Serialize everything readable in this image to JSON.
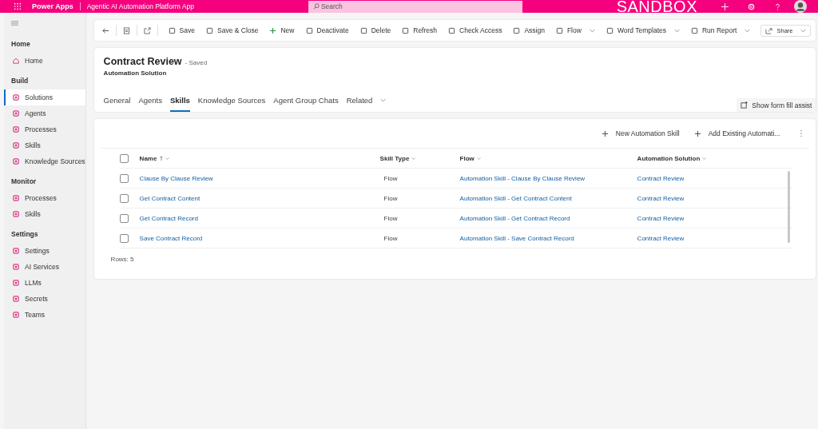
{
  "top_bar": {
    "app_name": "Power Apps",
    "app_title": "Agentic AI Automation Platform App",
    "search": {
      "placeholder": "Search"
    },
    "environment": "SANDBOX"
  },
  "sidebar": {
    "sections": [
      {
        "title": "Home",
        "items": [
          {
            "label": "Home",
            "selected": false
          }
        ]
      },
      {
        "title": "Build",
        "items": [
          {
            "label": "Solutions",
            "selected": true
          },
          {
            "label": "Agents",
            "selected": false
          },
          {
            "label": "Processes",
            "selected": false
          },
          {
            "label": "Skills",
            "selected": false
          },
          {
            "label": "Knowledge Sources",
            "selected": false
          }
        ]
      },
      {
        "title": "Monitor",
        "items": [
          {
            "label": "Processes",
            "selected": false
          },
          {
            "label": "Skills",
            "selected": false
          }
        ]
      },
      {
        "title": "Settings",
        "items": [
          {
            "label": "Settings",
            "selected": false
          },
          {
            "label": "AI Services",
            "selected": false
          },
          {
            "label": "LLMs",
            "selected": false
          },
          {
            "label": "Secrets",
            "selected": false
          },
          {
            "label": "Teams",
            "selected": false
          }
        ]
      }
    ]
  },
  "command_bar": {
    "buttons": [
      {
        "label": "Save",
        "dropdown": false
      },
      {
        "label": "Save & Close",
        "dropdown": false
      },
      {
        "label": "New",
        "dropdown": false
      },
      {
        "label": "Deactivate",
        "dropdown": false
      },
      {
        "label": "Delete",
        "dropdown": false
      },
      {
        "label": "Refresh",
        "dropdown": false
      },
      {
        "label": "Check Access",
        "dropdown": false
      },
      {
        "label": "Assign",
        "dropdown": false
      },
      {
        "label": "Flow",
        "dropdown": true
      },
      {
        "label": "Word Templates",
        "dropdown": true
      },
      {
        "label": "Run Report",
        "dropdown": true
      }
    ],
    "share": "Share"
  },
  "form": {
    "title": "Contract Review",
    "status": "- Saved",
    "entity": "Automation Solution",
    "tabs": [
      {
        "label": "General",
        "selected": false
      },
      {
        "label": "Agents",
        "selected": false
      },
      {
        "label": "Skills",
        "selected": true
      },
      {
        "label": "Knowledge Sources",
        "selected": false
      },
      {
        "label": "Agent Group Chats",
        "selected": false
      },
      {
        "label": "Related",
        "selected": false
      }
    ],
    "form_fill_assist": "Show form fill assist"
  },
  "grid": {
    "select_all_checked": false,
    "actions": [
      "New Automation Skill",
      "Add Existing Automati..."
    ],
    "columns": [
      "Name",
      "Skill Type",
      "Flow",
      "Automation Solution"
    ],
    "rows": [
      {
        "name": "Clause By Clause Review",
        "skill_type": "Flow",
        "flow": "Automation Skill - Clause By Clause Review",
        "solution": "Contract Review",
        "checked": false
      },
      {
        "name": "Get Contract Content",
        "skill_type": "Flow",
        "flow": "Automation Skill - Get Contract Content",
        "solution": "Contract Review",
        "checked": false
      },
      {
        "name": "Get Contract Record",
        "skill_type": "Flow",
        "flow": "Automation Skill - Get Contract Record",
        "solution": "Contract Review",
        "checked": false
      },
      {
        "name": "Save Contract Record",
        "skill_type": "Flow",
        "flow": "Automation Skill - Save Contract Record",
        "solution": "Contract Review",
        "checked": false
      }
    ],
    "footer": "Rows: 5"
  }
}
